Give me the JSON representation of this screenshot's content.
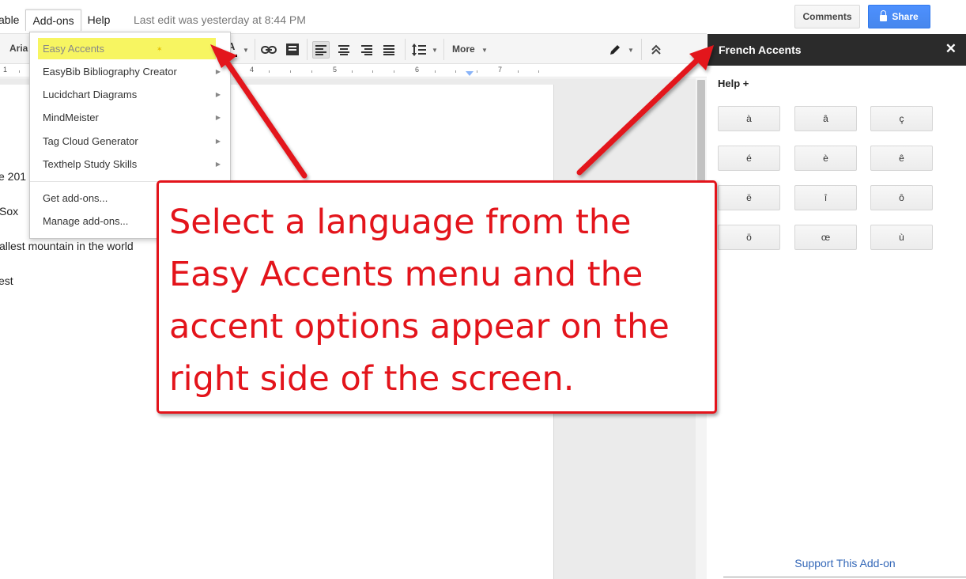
{
  "menubar": {
    "items": [
      "able",
      "Add-ons",
      "Help"
    ],
    "last_edit": "Last edit was yesterday at 8:44 PM"
  },
  "header": {
    "comments_label": "Comments",
    "share_label": "Share"
  },
  "toolbar": {
    "font_name": "Aria",
    "text_color_glyph": "A",
    "more_label": "More"
  },
  "ruler": {
    "labels": [
      "1",
      "4",
      "5",
      "6",
      "7"
    ]
  },
  "document": {
    "lines": [
      "e 201",
      "Sox",
      "allest mountain in the world",
      "est"
    ]
  },
  "addons_menu": {
    "items": [
      {
        "label": "Easy Accents",
        "has_submenu": true,
        "highlighted": true
      },
      {
        "label": "EasyBib Bibliography Creator",
        "has_submenu": true
      },
      {
        "label": "Lucidchart Diagrams",
        "has_submenu": true
      },
      {
        "label": "MindMeister",
        "has_submenu": true
      },
      {
        "label": "Tag Cloud Generator",
        "has_submenu": true
      },
      {
        "label": "Texthelp Study Skills",
        "has_submenu": true
      },
      {
        "label": "Get add-ons...",
        "has_submenu": false
      },
      {
        "label": "Manage add-ons...",
        "has_submenu": false
      }
    ]
  },
  "sidebar": {
    "title": "French Accents",
    "help_label": "Help +",
    "accents": [
      "à",
      "â",
      "ç",
      "é",
      "è",
      "ê",
      "ë",
      "î",
      "ô",
      "ö",
      "œ",
      "ù"
    ],
    "support_link": "Support This Add-on"
  },
  "annotation": {
    "text": "Select a language from the Easy Accents menu and the accent options appear on the right side of the screen.",
    "color": "#e3141b"
  },
  "colors": {
    "share_blue": "#4d90fe",
    "highlight_yellow": "#f7f561",
    "sidebar_header": "#2b2b2b",
    "link_blue": "#3367b8"
  }
}
